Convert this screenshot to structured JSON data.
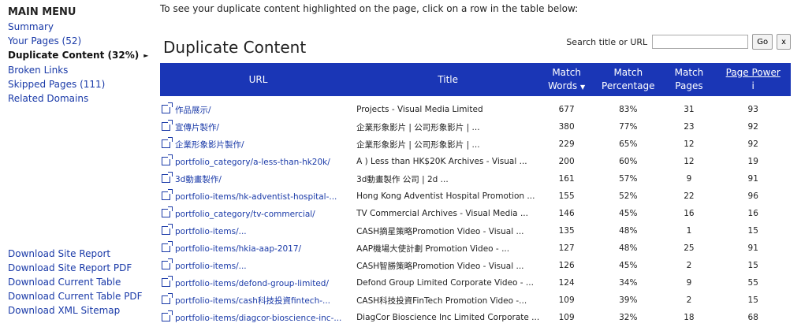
{
  "sidebar": {
    "title": "MAIN MENU",
    "items": [
      {
        "label": "Summary"
      },
      {
        "label": "Your Pages (52)"
      },
      {
        "label": "Duplicate Content (32%)"
      },
      {
        "label": "Broken Links"
      },
      {
        "label": "Skipped Pages (111)"
      },
      {
        "label": "Related Domains"
      }
    ],
    "active_arrow": "►",
    "downloads": [
      {
        "label": "Download Site Report"
      },
      {
        "label": "Download Site Report PDF"
      },
      {
        "label": "Download Current Table"
      },
      {
        "label": "Download Current Table PDF"
      },
      {
        "label": "Download XML Sitemap"
      }
    ]
  },
  "main": {
    "instructions": "To see your duplicate content highlighted on the page, click on a row in the table below:",
    "title": "Duplicate Content",
    "search": {
      "label": "Search title or URL",
      "value": "",
      "go_label": "Go",
      "clear_label": "x"
    }
  },
  "table": {
    "headers": {
      "url": "URL",
      "title": "Title",
      "match_words_1": "Match",
      "match_words_2": "Words",
      "sort_glyph": "▼",
      "match_pct_1": "Match",
      "match_pct_2": "Percentage",
      "match_pages_1": "Match",
      "match_pages_2": "Pages",
      "page_power": "Page Power",
      "info_glyph": "i"
    },
    "rows": [
      {
        "url": "作品展示/",
        "title": "Projects - Visual Media Limited",
        "words": "677",
        "pct": "83%",
        "pages": "31",
        "power": "93"
      },
      {
        "url": "宣傳片製作/",
        "title": "企業形象影片 | 公司形象影片 | ...",
        "words": "380",
        "pct": "77%",
        "pages": "23",
        "power": "92"
      },
      {
        "url": "企業形象影片製作/",
        "title": "企業形象影片 | 公司形象影片 | ...",
        "words": "229",
        "pct": "65%",
        "pages": "12",
        "power": "92"
      },
      {
        "url": "portfolio_category/a-less-than-hk20k/",
        "title": "A ) Less than HK$20K Archives - Visual ...",
        "words": "200",
        "pct": "60%",
        "pages": "12",
        "power": "19"
      },
      {
        "url": "3d動畫製作/",
        "title": "3d動畫製作 公司 | 2d ...",
        "words": "161",
        "pct": "57%",
        "pages": "9",
        "power": "91"
      },
      {
        "url": "portfolio-items/hk-adventist-hospital-...",
        "title": "Hong Kong Adventist Hospital Promotion ...",
        "words": "155",
        "pct": "52%",
        "pages": "22",
        "power": "96"
      },
      {
        "url": "portfolio_category/tv-commercial/",
        "title": "TV Commercial Archives - Visual Media ...",
        "words": "146",
        "pct": "45%",
        "pages": "16",
        "power": "16"
      },
      {
        "url": "portfolio-items/...",
        "title": "CASH摘星策略Promotion Video - Visual ...",
        "words": "135",
        "pct": "48%",
        "pages": "1",
        "power": "15"
      },
      {
        "url": "portfolio-items/hkia-aap-2017/",
        "title": "AAP機場大使計劃 Promotion Video - ...",
        "words": "127",
        "pct": "48%",
        "pages": "25",
        "power": "91"
      },
      {
        "url": "portfolio-items/...",
        "title": "CASH智勝策略Promotion Video - Visual ...",
        "words": "126",
        "pct": "45%",
        "pages": "2",
        "power": "15"
      },
      {
        "url": "portfolio-items/defond-group-limited/",
        "title": "Defond Group Limited Corporate Video - ...",
        "words": "124",
        "pct": "34%",
        "pages": "9",
        "power": "55"
      },
      {
        "url": "portfolio-items/cash科技投資fintech-...",
        "title": "CASH科技投資FinTech Promotion Video -...",
        "words": "109",
        "pct": "39%",
        "pages": "2",
        "power": "15"
      },
      {
        "url": "portfolio-items/diagcor-bioscience-inc-...",
        "title": "DiagCor Bioscience Inc Limited Corporate ...",
        "words": "109",
        "pct": "32%",
        "pages": "18",
        "power": "68"
      }
    ]
  }
}
